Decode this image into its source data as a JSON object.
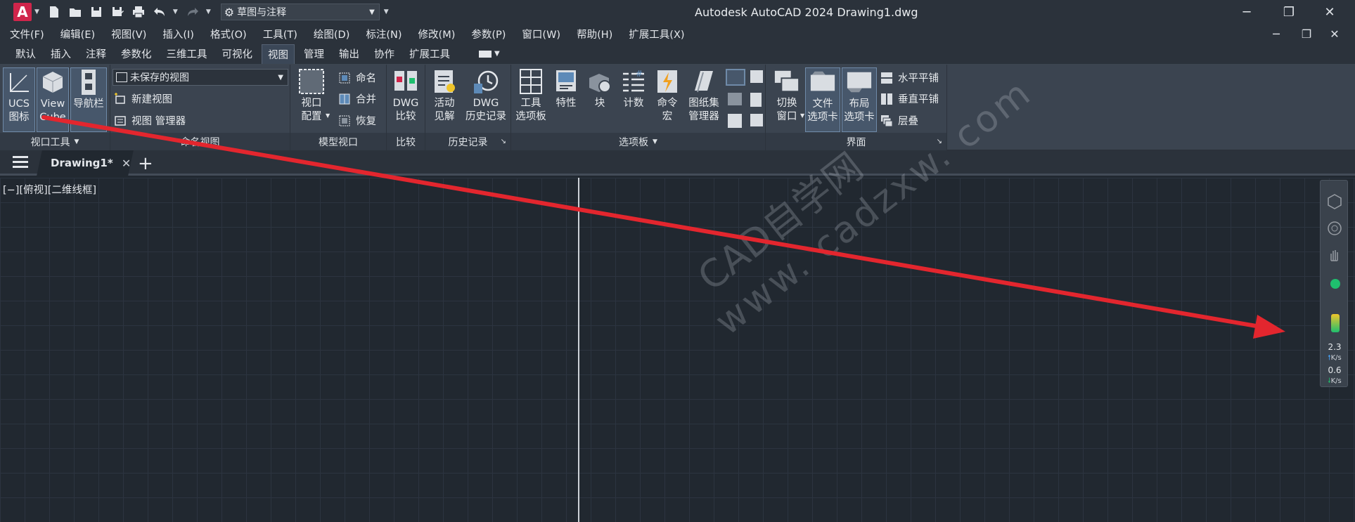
{
  "titlebar": {
    "logo_letter": "A",
    "workspace": "草图与注释",
    "title": "Autodesk AutoCAD 2024    Drawing1.dwg",
    "minimize_icon": "─",
    "restore_icon": "❐",
    "close_icon": "✕"
  },
  "menubar": {
    "items": [
      "文件(F)",
      "编辑(E)",
      "视图(V)",
      "插入(I)",
      "格式(O)",
      "工具(T)",
      "绘图(D)",
      "标注(N)",
      "修改(M)",
      "参数(P)",
      "窗口(W)",
      "帮助(H)",
      "扩展工具(X)"
    ]
  },
  "ribbon_tabs": {
    "items": [
      "默认",
      "插入",
      "注释",
      "参数化",
      "三维工具",
      "可视化",
      "视图",
      "管理",
      "输出",
      "协作",
      "扩展工具"
    ],
    "active": "视图"
  },
  "ribbon": {
    "viewport_tools": {
      "title": "视口工具",
      "ucs": [
        "UCS",
        "图标"
      ],
      "viewcube": [
        "View",
        "Cube"
      ],
      "navbar": "导航栏"
    },
    "named_views": {
      "title": "命名视图",
      "current": "未保存的视图",
      "new_view": "新建视图",
      "view_manager": "视图 管理器"
    },
    "model_viewports": {
      "title": "模型视口",
      "config": [
        "视口",
        "配置"
      ],
      "name": "命名",
      "join": "合并",
      "restore": "恢复"
    },
    "compare": {
      "title": "比较",
      "dwg_compare": [
        "DWG",
        "比较"
      ]
    },
    "history": {
      "title": "历史记录",
      "active_insights": [
        "活动",
        "见解"
      ],
      "dwg_history": [
        "DWG",
        "历史记录"
      ]
    },
    "palettes": {
      "title": "选项板",
      "tool_palettes": [
        "工具",
        "选项板"
      ],
      "properties": "特性",
      "block": "块",
      "count": "计数",
      "command_macro": [
        "命令",
        "宏"
      ],
      "sheet_set": [
        "图纸集",
        "管理器"
      ]
    },
    "interface": {
      "title": "界面",
      "switch_window": [
        "切换",
        "窗口"
      ],
      "file_tabs": [
        "文件",
        "选项卡"
      ],
      "layout_tabs": [
        "布局",
        "选项卡"
      ],
      "tile_horizontal": "水平平铺",
      "tile_vertical": "垂直平铺",
      "cascade": "层叠"
    }
  },
  "filetabs": {
    "drawing_tab": "Drawing1*",
    "close_icon": "✕",
    "new_tab": "+"
  },
  "canvas": {
    "viewport_label": "[−][俯视][二维线框]"
  },
  "network": {
    "upload_value": "2.3",
    "upload_unit": "K/s",
    "download_value": "0.6",
    "download_unit": "K/s"
  },
  "watermark": {
    "line1": "CAD自学网",
    "line2": "www. cadzxw. com"
  },
  "colors": {
    "logo": "#d0254b",
    "annotation_arrow": "#e3262e",
    "active_tab": "#3b4757"
  }
}
